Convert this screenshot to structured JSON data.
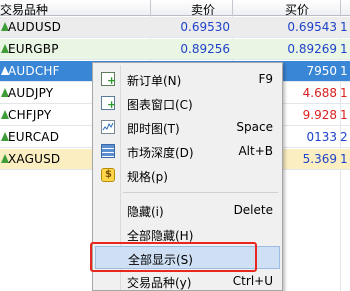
{
  "market_watch": {
    "headers": {
      "symbol": "交易品种",
      "bid": "卖价",
      "ask": "买价"
    },
    "rows": [
      {
        "symbol": "AUDUSD",
        "bid": "0.69530",
        "ask": "0.69543",
        "tail": "1",
        "style": "highlight",
        "ask_color": "blue"
      },
      {
        "symbol": "EURGBP",
        "bid": "0.89256",
        "ask": "0.89269",
        "tail": "1",
        "style": "green",
        "ask_color": "blue"
      },
      {
        "symbol": "AUDCHF",
        "bid": "",
        "ask": "7950",
        "tail": "1",
        "style": "selected",
        "ask_color": "white"
      },
      {
        "symbol": "AUDJPY",
        "bid": "",
        "ask": "4.688",
        "tail": "1",
        "style": "plain",
        "ask_color": "red"
      },
      {
        "symbol": "CHFJPY",
        "bid": "",
        "ask": "9.928",
        "tail": "1",
        "style": "plain",
        "ask_color": "red"
      },
      {
        "symbol": "EURCAD",
        "bid": "",
        "ask": "0133",
        "tail": "2",
        "style": "plain",
        "ask_color": "blue"
      },
      {
        "symbol": "XAGUSD",
        "bid": "",
        "ask": "5.369",
        "tail": "1",
        "style": "yellow",
        "ask_color": "blue"
      }
    ]
  },
  "context_menu": {
    "items": [
      {
        "label": "新订单(N)",
        "shortcut": "F9",
        "icon": "new-order-icon"
      },
      {
        "label": "图表窗口(C)",
        "shortcut": "",
        "icon": "chart-window-icon"
      },
      {
        "label": "即时图(T)",
        "shortcut": "Space",
        "icon": "tick-chart-icon"
      },
      {
        "label": "市场深度(D)",
        "shortcut": "Alt+B",
        "icon": "market-depth-icon"
      },
      {
        "label": "规格(p)",
        "shortcut": "",
        "icon": "specification-icon"
      },
      {
        "label": "隐藏(i)",
        "shortcut": "Delete",
        "icon": ""
      },
      {
        "label": "全部隐藏(H)",
        "shortcut": "",
        "icon": ""
      },
      {
        "label": "全部显示(S)",
        "shortcut": "",
        "icon": "",
        "hovered": true
      },
      {
        "label": "交易品种(y)",
        "shortcut": "Ctrl+U",
        "icon": ""
      }
    ]
  },
  "colors": {
    "selected_row": "#3a86d6",
    "bid_text": "#1f43c9",
    "ask_down_text": "#d91f1f",
    "highlight_box": "#e8281e",
    "menu_hover": "#cfe0f5"
  }
}
